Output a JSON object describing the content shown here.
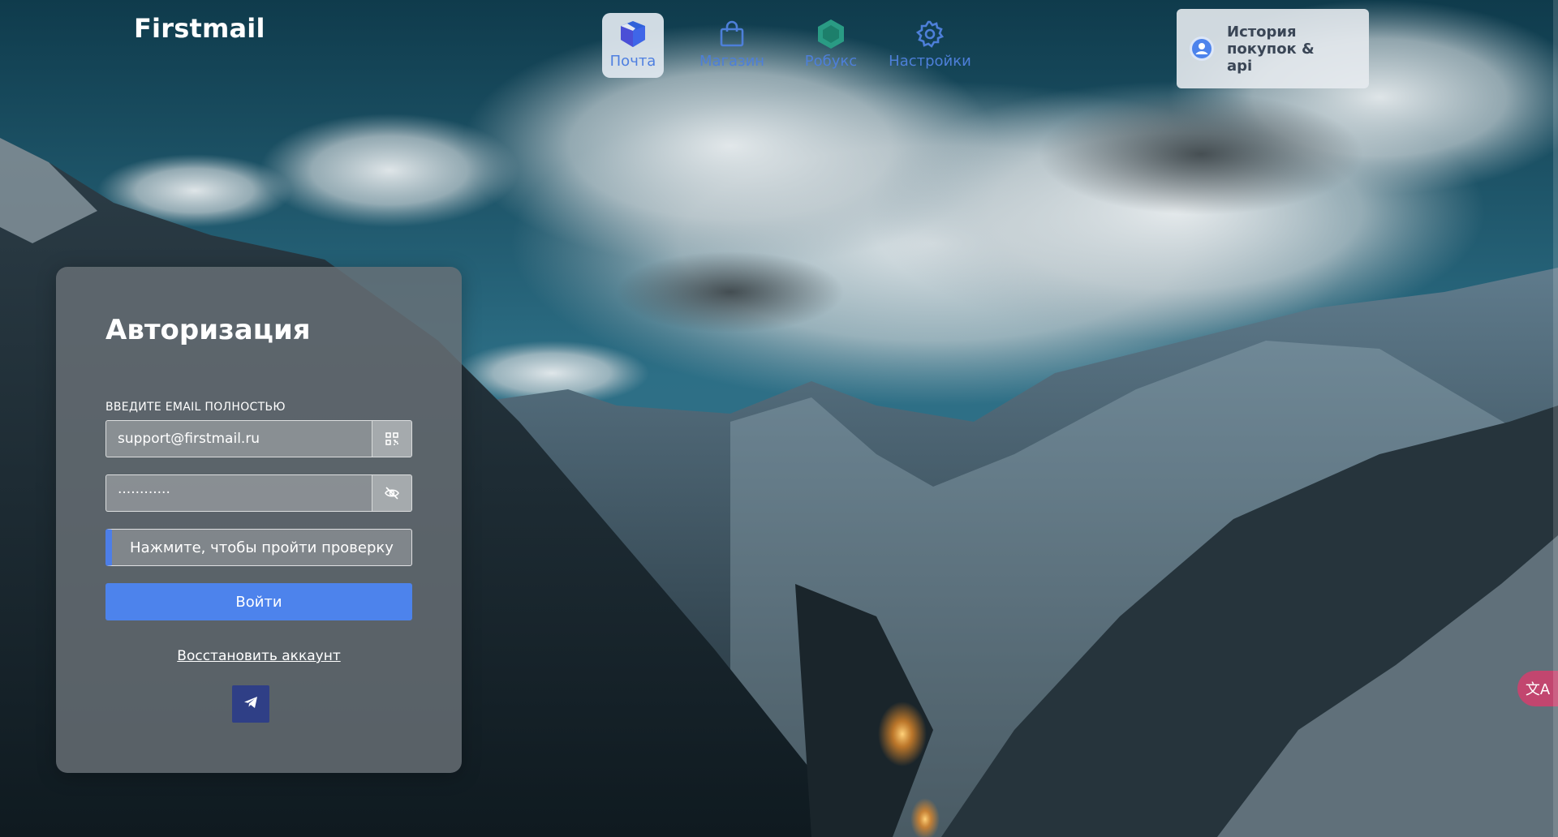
{
  "brand": {
    "name": "Firstmail"
  },
  "nav": {
    "items": [
      {
        "label": "Почта",
        "icon": "mail-cube-icon",
        "active": true
      },
      {
        "label": "Магазин",
        "icon": "shopping-bag-icon",
        "active": false
      },
      {
        "label": "Робукс",
        "icon": "hexagon-icon",
        "active": false
      },
      {
        "label": "Настройки",
        "icon": "gear-icon",
        "active": false
      }
    ]
  },
  "history": {
    "label": "История покупок & api",
    "icon": "user-icon"
  },
  "auth": {
    "title": "Авторизация",
    "email_label": "ВВЕДИТЕ EMAIL ПОЛНОСТЬЮ",
    "email_value": "support@firstmail.ru",
    "password_value": "············",
    "captcha_label": "Нажмите, чтобы пройти проверку",
    "login_label": "Войти",
    "recover_label": "Восстановить аккаунт"
  },
  "colors": {
    "accent": "#4d83ec",
    "card_bg": "#697076",
    "telegram_bg": "#2f3f86",
    "translate_bg": "#c2466f"
  },
  "widgets": {
    "translate_glyph": "文A"
  }
}
